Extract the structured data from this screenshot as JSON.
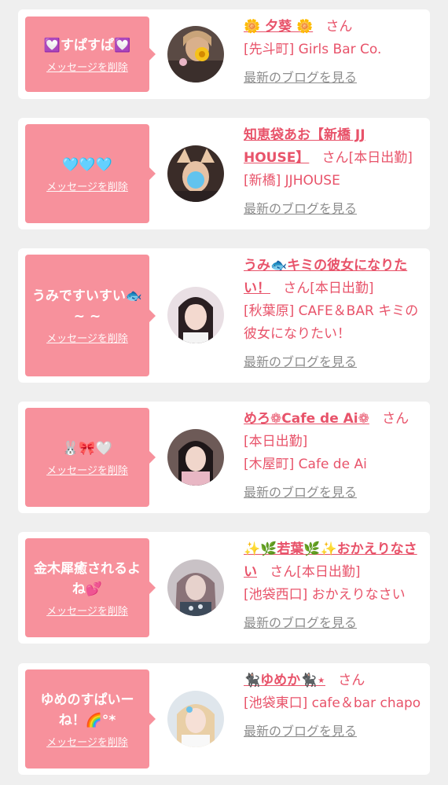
{
  "common": {
    "delete_label": "メッセージを削除",
    "blog_label": "最新のブログを見る",
    "san": "さん"
  },
  "colors": {
    "page_bg": "#efefef",
    "bubble": "#f7919c",
    "accent_text": "#e8536a",
    "muted_link": "#8d8d8d"
  },
  "items": [
    {
      "message": "💟すぱすぱ💟",
      "name": "🌼 夕葵 🌼",
      "status": "",
      "shop": "[先斗町] Girls Bar Co."
    },
    {
      "message": "🩵🩵🩵",
      "name": "知恵袋あお【新橋 JJ HOUSE】",
      "status": "[本日出勤]",
      "shop": "[新橋] JJHOUSE"
    },
    {
      "message": "うみですいすい🐟 ~ ~",
      "name": "うみ🐟キミの彼女になりたい！",
      "status": "[本日出勤]",
      "shop": "[秋葉原] CAFE＆BAR キミの彼女になりたい！"
    },
    {
      "message": "🐰🎀🤍",
      "name": "めろ❁Cafe de Ai❁",
      "status": "[本日出勤]",
      "shop": "[木屋町] Cafe de Ai"
    },
    {
      "message": "金木犀癒されるよね💕",
      "name": "✨🌿若葉🌿✨おかえりなさい",
      "status": "[本日出勤]",
      "shop": "[池袋西口] おかえりなさい"
    },
    {
      "message": "ゆめのすぱいーね！🌈°*",
      "name": "🐈‍⬛ゆめか🐈‍⬛⋆",
      "status": "",
      "shop": "[池袋東口] cafe＆bar chapo"
    }
  ]
}
